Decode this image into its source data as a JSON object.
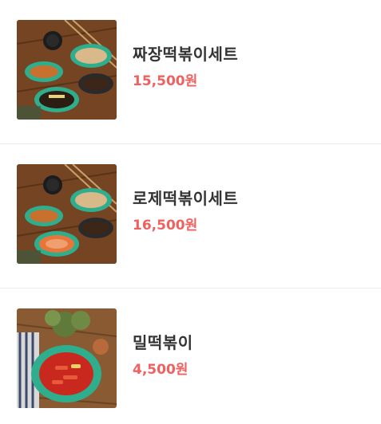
{
  "menu": {
    "items": [
      {
        "name": "짜장떡볶이세트",
        "price": "15,500원",
        "image": "jjajang-tteokbokki-set-photo"
      },
      {
        "name": "로제떡볶이세트",
        "price": "16,500원",
        "image": "rose-tteokbokki-set-photo"
      },
      {
        "name": "밀떡볶이",
        "price": "4,500원",
        "image": "wheat-tteokbokki-photo"
      }
    ]
  },
  "colors": {
    "price": "#f0605e",
    "name": "#333333",
    "divider": "#ececec",
    "plate": "#2fae8e",
    "wood": "#7a4a26"
  }
}
